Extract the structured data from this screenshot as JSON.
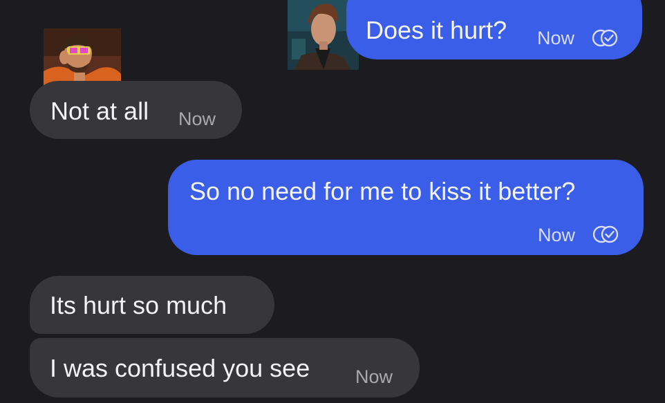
{
  "colors": {
    "background": "#1c1c20",
    "incoming_bubble": "#36363b",
    "outgoing_bubble": "#3b5ee8",
    "timestamp_incoming": "#a9a9ae",
    "timestamp_outgoing": "#d7ddfb"
  },
  "messages": [
    {
      "direction": "outgoing",
      "text": "Does it hurt?",
      "time": "Now",
      "status_icon": "read-receipt-icon"
    },
    {
      "direction": "incoming",
      "text": "Not at all",
      "time": "Now"
    },
    {
      "direction": "outgoing",
      "text": "So no need for me to kiss it better?",
      "time": "Now",
      "status_icon": "read-receipt-icon"
    },
    {
      "direction": "incoming",
      "text": "Its hurt so much"
    },
    {
      "direction": "incoming",
      "text": "I was confused you see",
      "time": "Now"
    }
  ]
}
